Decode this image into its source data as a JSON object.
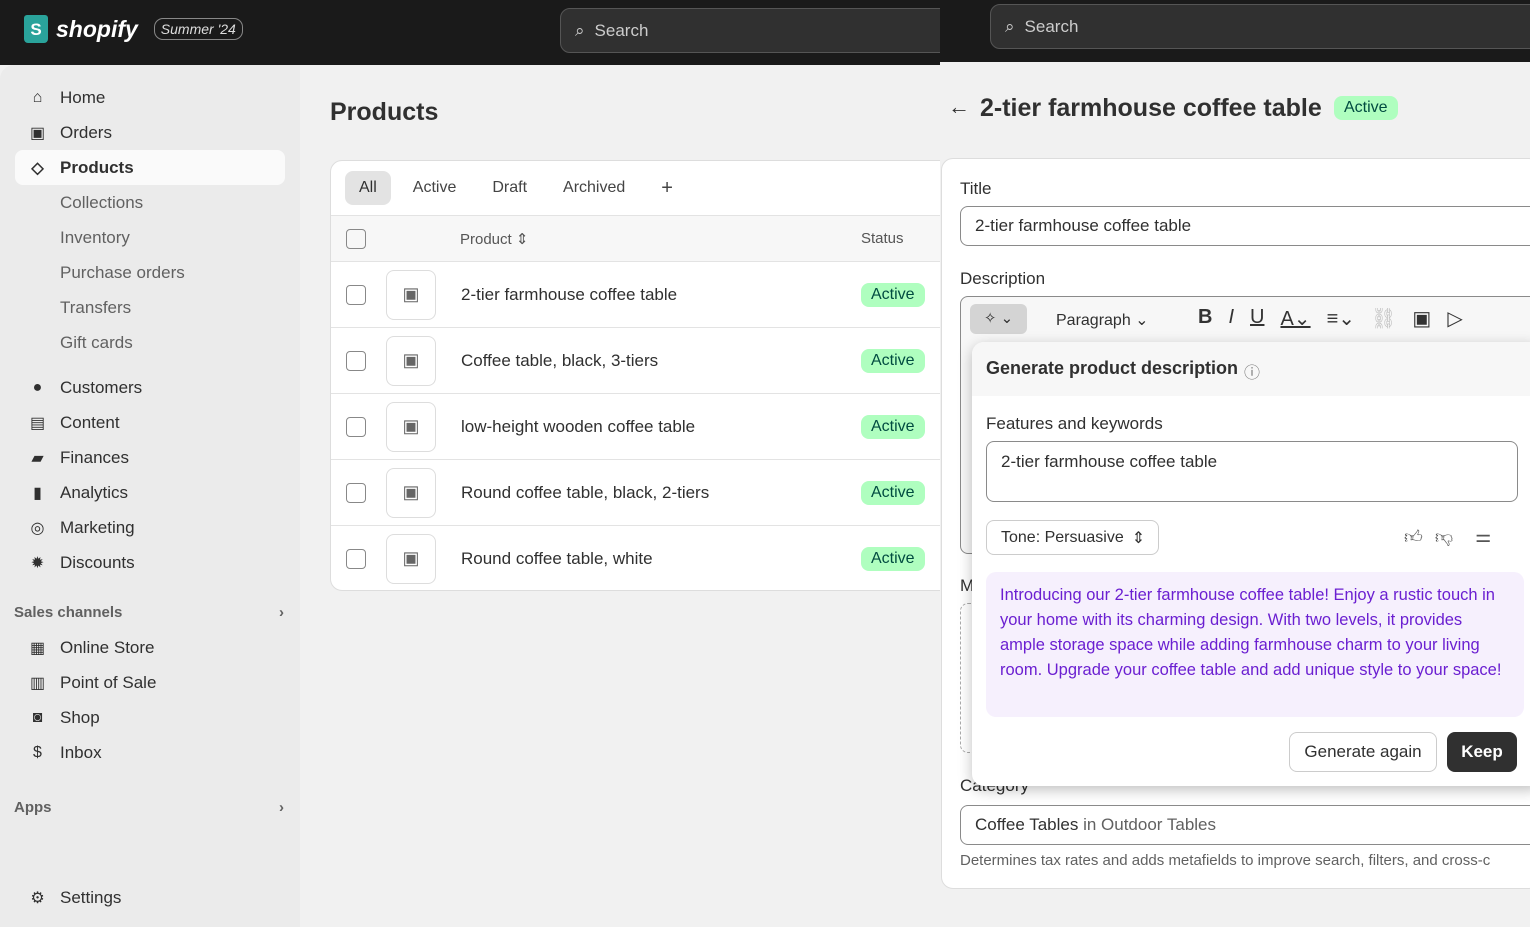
{
  "header": {
    "brand": "shopify",
    "season": "Summer '24",
    "search_placeholder": "Search"
  },
  "sidebar": {
    "items": [
      {
        "label": "Home",
        "icon": "home-icon",
        "glyph": "⌂"
      },
      {
        "label": "Orders",
        "icon": "inbox-icon",
        "glyph": "▣"
      },
      {
        "label": "Products",
        "icon": "tag-icon",
        "glyph": "◇",
        "selected": true
      },
      {
        "label": "Collections",
        "sub": true
      },
      {
        "label": "Inventory",
        "sub": true
      },
      {
        "label": "Purchase orders",
        "sub": true
      },
      {
        "label": "Transfers",
        "sub": true
      },
      {
        "label": "Gift cards",
        "sub": true
      },
      {
        "label": "Customers",
        "icon": "person-icon",
        "glyph": "●"
      },
      {
        "label": "Content",
        "icon": "content-icon",
        "glyph": "▤"
      },
      {
        "label": "Finances",
        "icon": "bank-icon",
        "glyph": "▰"
      },
      {
        "label": "Analytics",
        "icon": "bar-chart-icon",
        "glyph": "▮"
      },
      {
        "label": "Marketing",
        "icon": "target-icon",
        "glyph": "◎"
      },
      {
        "label": "Discounts",
        "icon": "discount-icon",
        "glyph": "✹"
      }
    ],
    "sales_channels_label": "Sales channels",
    "channels": [
      {
        "label": "Online Store",
        "icon": "store-icon",
        "glyph": "▦"
      },
      {
        "label": "Point of Sale",
        "icon": "pos-icon",
        "glyph": "▥"
      },
      {
        "label": "Shop",
        "icon": "shop-icon",
        "glyph": "◙"
      },
      {
        "label": "Inbox",
        "icon": "inbox-chat-icon",
        "glyph": "$"
      }
    ],
    "apps_label": "Apps",
    "settings_label": "Settings"
  },
  "products": {
    "title": "Products",
    "tabs": [
      "All",
      "Active",
      "Draft",
      "Archived"
    ],
    "col_product": "Product",
    "col_status": "Status",
    "rows": [
      {
        "name": "2-tier farmhouse coffee table",
        "status": "Active"
      },
      {
        "name": "Coffee table, black, 3-tiers",
        "status": "Active"
      },
      {
        "name": "low-height wooden coffee table",
        "status": "Active"
      },
      {
        "name": "Round coffee table, black, 2-tiers",
        "status": "Active"
      },
      {
        "name": "Round coffee table, white",
        "status": "Active"
      }
    ]
  },
  "detail": {
    "title": "2-tier farmhouse coffee table",
    "status": "Active",
    "title_label": "Title",
    "title_value": "2-tier farmhouse coffee table",
    "description_label": "Description",
    "paragraph": "Paragraph",
    "media_label_partial": "M",
    "category_label": "Category",
    "category_value": "Coffee Tables",
    "category_in": " in Outdoor Tables",
    "category_help": "Determines tax rates and adds metafields to improve search, filters, and cross-c"
  },
  "generator": {
    "heading": "Generate product description",
    "features_label": "Features and keywords",
    "features_value": "2-tier farmhouse coffee table",
    "tone": "Tone: Persuasive",
    "output": "Introducing our 2-tier farmhouse coffee table! Enjoy a rustic touch in your home with its charming design. With two levels, it provides ample storage space while adding farmhouse charm to your living room. Upgrade your coffee table and add unique style to your space!",
    "generate_again": "Generate again",
    "keep": "Keep"
  },
  "colors": {
    "accent_purple": "#6b1fd1",
    "badge_green": "#affebf",
    "output_bg": "#f6f0fd"
  }
}
